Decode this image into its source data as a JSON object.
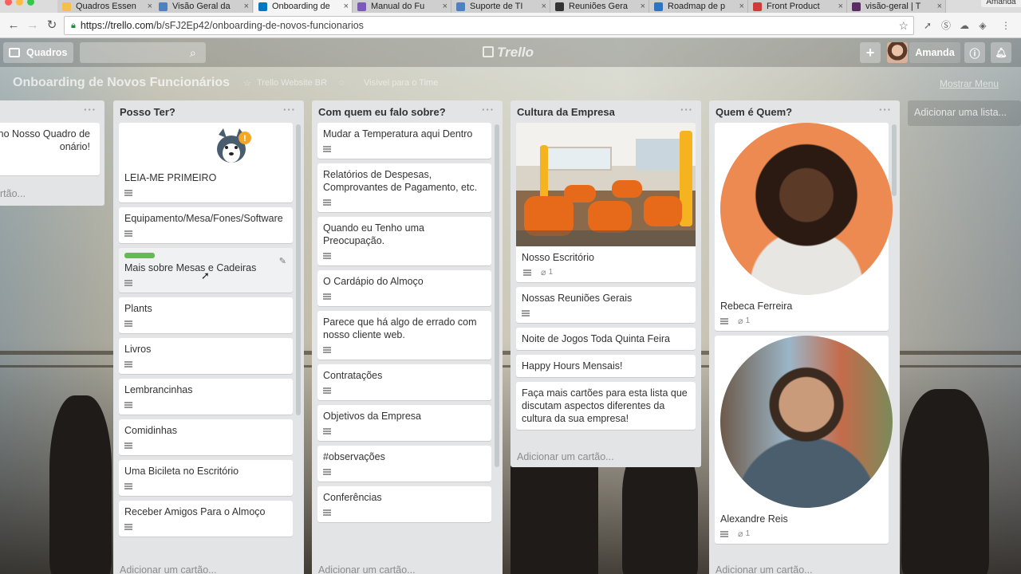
{
  "browser": {
    "tabs": [
      {
        "title": "Quadros Essen",
        "color": "#f5c04a"
      },
      {
        "title": "Visão Geral da",
        "color": "#4f80bf"
      },
      {
        "title": "Onboarding de",
        "color": "#0079bf"
      },
      {
        "title": "Manual do Fu",
        "color": "#7b5bb7"
      },
      {
        "title": "Suporte de TI",
        "color": "#4f80bf"
      },
      {
        "title": "Reuniões Gera",
        "color": "#333333"
      },
      {
        "title": "Roadmap de p",
        "color": "#2f74c0"
      },
      {
        "title": "Front Product",
        "color": "#d03a3a"
      },
      {
        "title": "visão-geral | T",
        "color": "#5a2d62"
      }
    ],
    "user_tab": "Amanda",
    "url_host": "https://trello.com",
    "url_path": "/b/sFJ2Ep42/onboarding-de-novos-funcionarios"
  },
  "header": {
    "boards_label": "Quadros",
    "logo": "Trello",
    "user_name": "Amanda"
  },
  "board": {
    "title": "Onboarding de Novos Funcionários",
    "team": "Trello Website BR",
    "visibility": "Visível para o Time",
    "show_menu": "Mostrar Menu",
    "add_list": "Adicionar uma lista..."
  },
  "lists": {
    "first": {
      "card_text": "no Nosso Quadro de\nonário!",
      "add_card": "rtão..."
    },
    "posso_ter": {
      "title": "Posso Ter?",
      "add_card": "Adicionar um cartão...",
      "cards": [
        "LEIA-ME PRIMEIRO",
        "Equipamento/Mesa/Fones/Software",
        "Mais sobre Mesas e Cadeiras",
        "Plants",
        "Livros",
        "Lembrancinhas",
        "Comidinhas",
        "Uma Bicileta no Escritório",
        "Receber Amigos Para o Almoço"
      ]
    },
    "com_quem": {
      "title": "Com quem eu falo sobre?",
      "add_card": "Adicionar um cartão...",
      "cards": [
        "Mudar a Temperatura aqui Dentro",
        "Relatórios de Despesas, Comprovantes de Pagamento, etc.",
        "Quando eu Tenho uma Preocupação.",
        "O Cardápio do Almoço",
        "Parece que há algo de errado com nosso cliente web.",
        "Contratações",
        "Objetivos da Empresa",
        "#observações",
        "Conferências"
      ]
    },
    "cultura": {
      "title": "Cultura da Empresa",
      "add_card": "Adicionar um cartão...",
      "cards": [
        "Nosso Escritório",
        "Nossas Reuniões Gerais",
        "Noite de Jogos Toda Quinta Feira",
        "Happy Hours Mensais!",
        "Faça mais cartões para esta lista que discutam aspectos diferentes da cultura da sua empresa!"
      ],
      "attachments": "1"
    },
    "quem_e_quem": {
      "title": "Quem é Quem?",
      "add_card": "Adicionar um cartão...",
      "cards": [
        "Rebeca Ferreira",
        "Alexandre Reis"
      ],
      "attachments": "1"
    }
  }
}
